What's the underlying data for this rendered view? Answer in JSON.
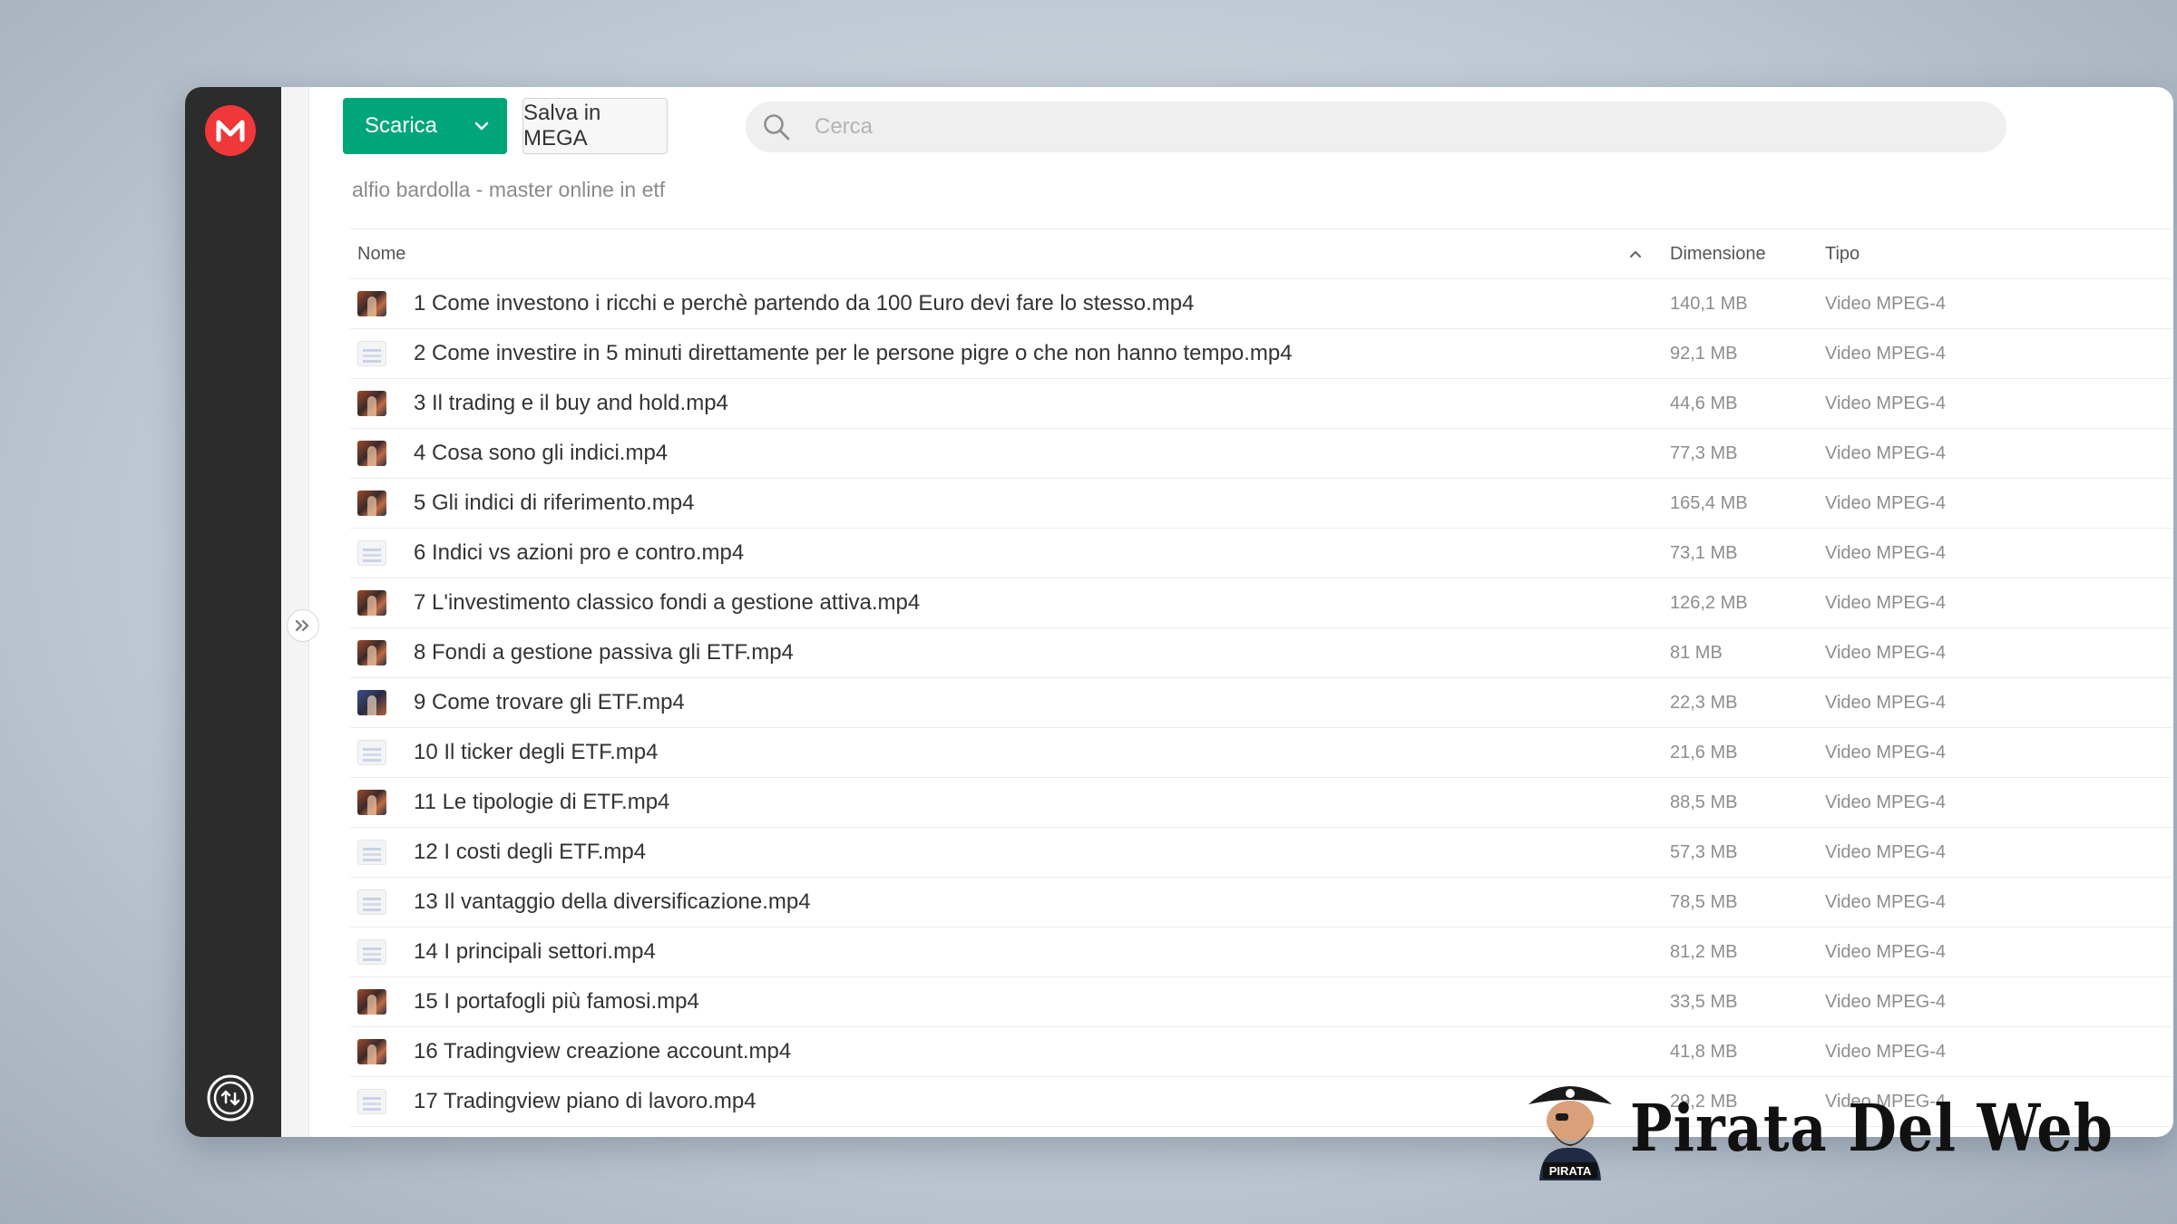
{
  "toolbar": {
    "download_label": "Scarica",
    "save_label": "Salva in MEGA"
  },
  "search": {
    "placeholder": "Cerca"
  },
  "breadcrumb": "alfio bardolla - master online in etf",
  "table": {
    "columns": {
      "name": "Nome",
      "size": "Dimensione",
      "type": "Tipo"
    },
    "rows": [
      {
        "name": "1 Come investono i ricchi e perchè partendo da 100 Euro devi fare lo stesso.mp4",
        "size": "140,1 MB",
        "type": "Video MPEG-4",
        "thumb": "dark"
      },
      {
        "name": "2 Come investire in 5 minuti direttamente per le persone pigre o che non hanno tempo.mp4",
        "size": "92,1 MB",
        "type": "Video MPEG-4",
        "thumb": "light"
      },
      {
        "name": "3 Il trading e il buy and hold.mp4",
        "size": "44,6 MB",
        "type": "Video MPEG-4",
        "thumb": "dark"
      },
      {
        "name": "4 Cosa sono gli indici.mp4",
        "size": "77,3 MB",
        "type": "Video MPEG-4",
        "thumb": "dark"
      },
      {
        "name": "5 Gli indici di riferimento.mp4",
        "size": "165,4 MB",
        "type": "Video MPEG-4",
        "thumb": "dark"
      },
      {
        "name": "6 Indici vs azioni pro e contro.mp4",
        "size": "73,1 MB",
        "type": "Video MPEG-4",
        "thumb": "light"
      },
      {
        "name": "7 L'investimento classico fondi a gestione attiva.mp4",
        "size": "126,2 MB",
        "type": "Video MPEG-4",
        "thumb": "dark"
      },
      {
        "name": "8 Fondi a gestione passiva gli ETF.mp4",
        "size": "81 MB",
        "type": "Video MPEG-4",
        "thumb": "dark"
      },
      {
        "name": "9 Come trovare gli ETF.mp4",
        "size": "22,3 MB",
        "type": "Video MPEG-4",
        "thumb": "blue"
      },
      {
        "name": "10 Il ticker degli ETF.mp4",
        "size": "21,6 MB",
        "type": "Video MPEG-4",
        "thumb": "light"
      },
      {
        "name": "11 Le tipologie di ETF.mp4",
        "size": "88,5 MB",
        "type": "Video MPEG-4",
        "thumb": "dark"
      },
      {
        "name": "12 I costi degli ETF.mp4",
        "size": "57,3 MB",
        "type": "Video MPEG-4",
        "thumb": "light"
      },
      {
        "name": "13 Il vantaggio della diversificazione.mp4",
        "size": "78,5 MB",
        "type": "Video MPEG-4",
        "thumb": "light"
      },
      {
        "name": "14 I principali settori.mp4",
        "size": "81,2 MB",
        "type": "Video MPEG-4",
        "thumb": "light"
      },
      {
        "name": "15 I portafogli più famosi.mp4",
        "size": "33,5 MB",
        "type": "Video MPEG-4",
        "thumb": "dark"
      },
      {
        "name": "16 Tradingview creazione account.mp4",
        "size": "41,8 MB",
        "type": "Video MPEG-4",
        "thumb": "dark"
      },
      {
        "name": "17 Tradingview piano di lavoro.mp4",
        "size": "29,2 MB",
        "type": "Video MPEG-4",
        "thumb": "light"
      }
    ]
  },
  "watermark": {
    "text": "Pirata Del Web",
    "badge_text": "PIRATA"
  },
  "colors": {
    "accent_green": "#00a67a",
    "mega_red": "#f0373a",
    "sidebar_bg": "#2c2c2c"
  },
  "icons": {
    "logo": "mega-logo-icon",
    "download_dropdown": "chevron-down-icon",
    "search": "search-icon",
    "sort": "chevron-up-icon",
    "expand": "double-chevron-right-icon",
    "transfers": "transfer-icon"
  }
}
